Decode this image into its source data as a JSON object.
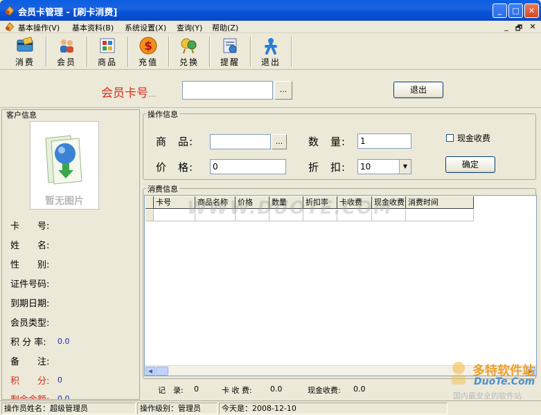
{
  "window": {
    "title": "会员卡管理 - [刷卡消费]",
    "min": "_",
    "max": "□",
    "close": "✕"
  },
  "menu": {
    "items": [
      "基本操作(V)",
      "基本资料(B)",
      "系统设置(X)",
      "查询(Y)",
      "帮助(Z)"
    ],
    "mdi": [
      "_",
      "🗗",
      "✕"
    ]
  },
  "toolbar": {
    "buttons": [
      {
        "label": "消费",
        "icon": "card-swipe-icon"
      },
      {
        "label": "会员",
        "icon": "members-icon"
      },
      {
        "label": "商品",
        "icon": "goods-icon"
      },
      {
        "label": "充值",
        "icon": "recharge-icon"
      },
      {
        "label": "兑换",
        "icon": "exchange-icon"
      },
      {
        "label": "提醒",
        "icon": "reminder-icon"
      },
      {
        "label": "退出",
        "icon": "exit-icon"
      }
    ]
  },
  "card": {
    "label": "会员卡号",
    "dots": "...",
    "value": "",
    "browse": "...",
    "exit": "退出"
  },
  "customer": {
    "group_title": "客户信息",
    "photo_placeholder": "暂无图片",
    "fields": {
      "card_no": "卡　　号:",
      "name": "姓　　名:",
      "gender": "性　　别:",
      "id_no": "证件号码:",
      "expiry": "到期日期:",
      "member_type": "会员类型:",
      "rate_label": "积 分 率:",
      "rate_value": "0.0",
      "remark": "备　　注:",
      "points_label": "积　　分:",
      "points_value": "0",
      "balance_label": "剩余金额:",
      "balance_value": "0.0"
    }
  },
  "operation": {
    "group_title": "操作信息",
    "goods_label": "商　品:",
    "goods_value": "",
    "goods_browse": "...",
    "qty_label": "数　量:",
    "qty_value": "1",
    "price_label": "价　格:",
    "price_value": "0",
    "discount_label": "折　扣:",
    "discount_value": "10",
    "cash_checkbox": "现金收费",
    "confirm": "确定"
  },
  "consumption": {
    "group_title": "消费信息",
    "columns": [
      "卡号",
      "商品名称",
      "价格",
      "数量",
      "折扣率",
      "卡收费",
      "现金收费",
      "消费时间"
    ],
    "watermark": "WWW.DUOTE.COM",
    "summary": {
      "records_label": "记　录:",
      "records_value": "0",
      "card_fee_label": "卡 收 费:",
      "card_fee_value": "0.0",
      "cash_fee_label": "现金收费:",
      "cash_fee_value": "0.0"
    }
  },
  "status": {
    "operator": "操作员姓名：超级管理员",
    "level": "操作级别：管理员",
    "today": "今天是：2008-12-10"
  },
  "watermark_logo": {
    "cn": "多特软件站",
    "en": "DuoTe.Com",
    "slogan": "国内最安全的软件站"
  }
}
